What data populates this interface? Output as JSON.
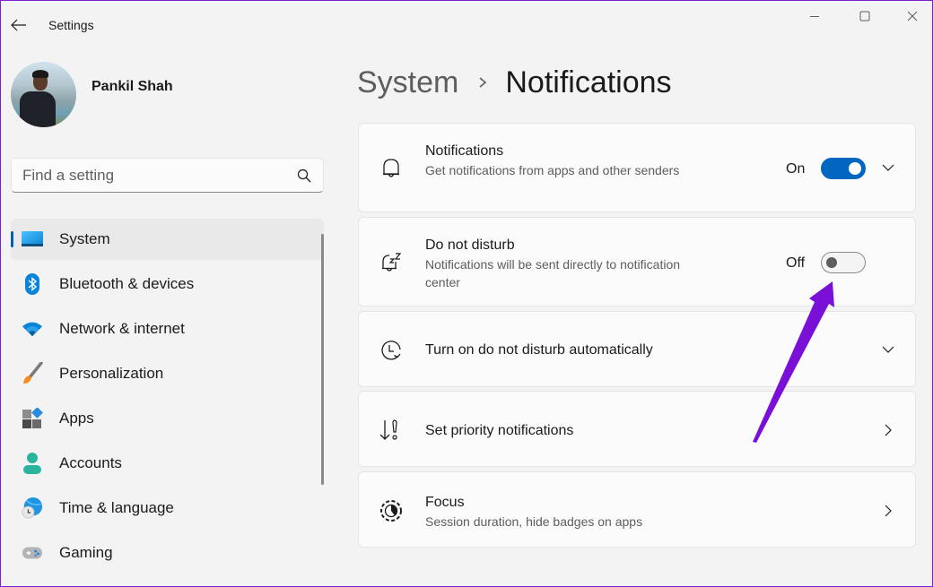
{
  "window": {
    "title": "Settings",
    "controls": {
      "minimize": "minimize",
      "maximize": "maximize",
      "close": "close"
    }
  },
  "profile": {
    "name": "Pankil Shah"
  },
  "search": {
    "placeholder": "Find a setting",
    "value": ""
  },
  "sidebar": {
    "items": [
      {
        "label": "System",
        "icon": "system-display-icon",
        "active": true
      },
      {
        "label": "Bluetooth & devices",
        "icon": "bluetooth-icon",
        "active": false
      },
      {
        "label": "Network & internet",
        "icon": "wifi-icon",
        "active": false
      },
      {
        "label": "Personalization",
        "icon": "paintbrush-icon",
        "active": false
      },
      {
        "label": "Apps",
        "icon": "apps-icon",
        "active": false
      },
      {
        "label": "Accounts",
        "icon": "account-icon",
        "active": false
      },
      {
        "label": "Time & language",
        "icon": "globe-clock-icon",
        "active": false
      },
      {
        "label": "Gaming",
        "icon": "gamepad-icon",
        "active": false
      }
    ]
  },
  "breadcrumb": {
    "parent": "System",
    "separator": "›",
    "current": "Notifications"
  },
  "cards": [
    {
      "title": "Notifications",
      "description": "Get notifications from apps and other senders",
      "icon": "bell-icon",
      "state_label": "On",
      "toggle_on": true,
      "action": "expand"
    },
    {
      "title": "Do not disturb",
      "description": "Notifications will be sent directly to notification center",
      "icon": "bell-snooze-icon",
      "state_label": "Off",
      "toggle_on": false,
      "action": "none"
    },
    {
      "title": "Turn on do not disturb automatically",
      "icon": "clock-refresh-icon",
      "action": "expand"
    },
    {
      "title": "Set priority notifications",
      "icon": "priority-arrow-icon",
      "action": "navigate"
    },
    {
      "title": "Focus",
      "description": "Session duration, hide badges on apps",
      "icon": "focus-timer-icon",
      "action": "navigate"
    }
  ],
  "colors": {
    "accent": "#0067c0",
    "annotation": "#7a10d8",
    "background": "#f3f3f3",
    "card": "#fbfbfb"
  }
}
